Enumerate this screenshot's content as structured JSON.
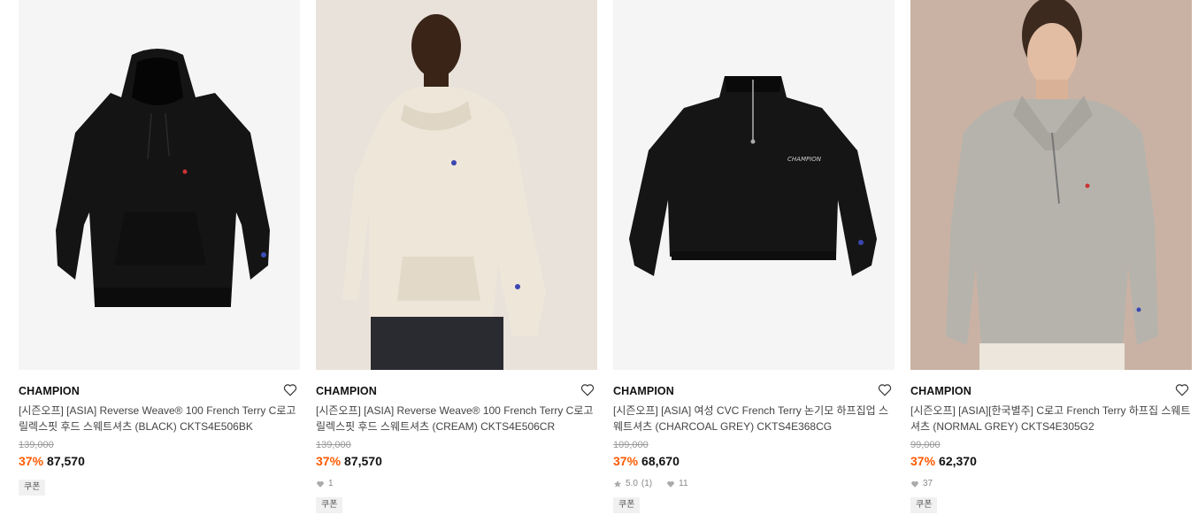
{
  "products": [
    {
      "brand": "CHAMPION",
      "name": "[시즌오프] [ASIA] Reverse Weave® 100 French Terry C로고 릴렉스핏 후드 스웨트셔츠 (BLACK) CKTS4E506BK",
      "original_price": "139,000",
      "discount": "37%",
      "price": "87,570",
      "coupon": "쿠폰"
    },
    {
      "brand": "CHAMPION",
      "name": "[시즌오프] [ASIA] Reverse Weave® 100 French Terry C로고 릴렉스핏 후드 스웨트셔츠 (CREAM) CKTS4E506CR",
      "original_price": "139,000",
      "discount": "37%",
      "price": "87,570",
      "likes": "1",
      "coupon": "쿠폰"
    },
    {
      "brand": "CHAMPION",
      "name": "[시즌오프] [ASIA] 여성 CVC French Terry 논기모 하프집업 스웨트셔츠 (CHARCOAL GREY) CKTS4E368CG",
      "original_price": "109,000",
      "discount": "37%",
      "price": "68,670",
      "rating": "5.0",
      "review_count": "(1)",
      "likes": "11",
      "coupon": "쿠폰"
    },
    {
      "brand": "CHAMPION",
      "name": "[시즌오프] [ASIA][한국별주] C로고 French Terry 하프집 스웨트셔츠 (NORMAL GREY) CKTS4E305G2",
      "original_price": "99,000",
      "discount": "37%",
      "price": "62,370",
      "likes": "37",
      "coupon": "쿠폰"
    }
  ],
  "icons": {
    "wishlist": "heart-outline-icon",
    "like": "heart-filled-icon",
    "rating": "star-icon"
  },
  "colors": {
    "discount": "#ff5a00",
    "text": "#222222",
    "muted": "#999999",
    "coupon_bg": "#f1f1f1"
  }
}
